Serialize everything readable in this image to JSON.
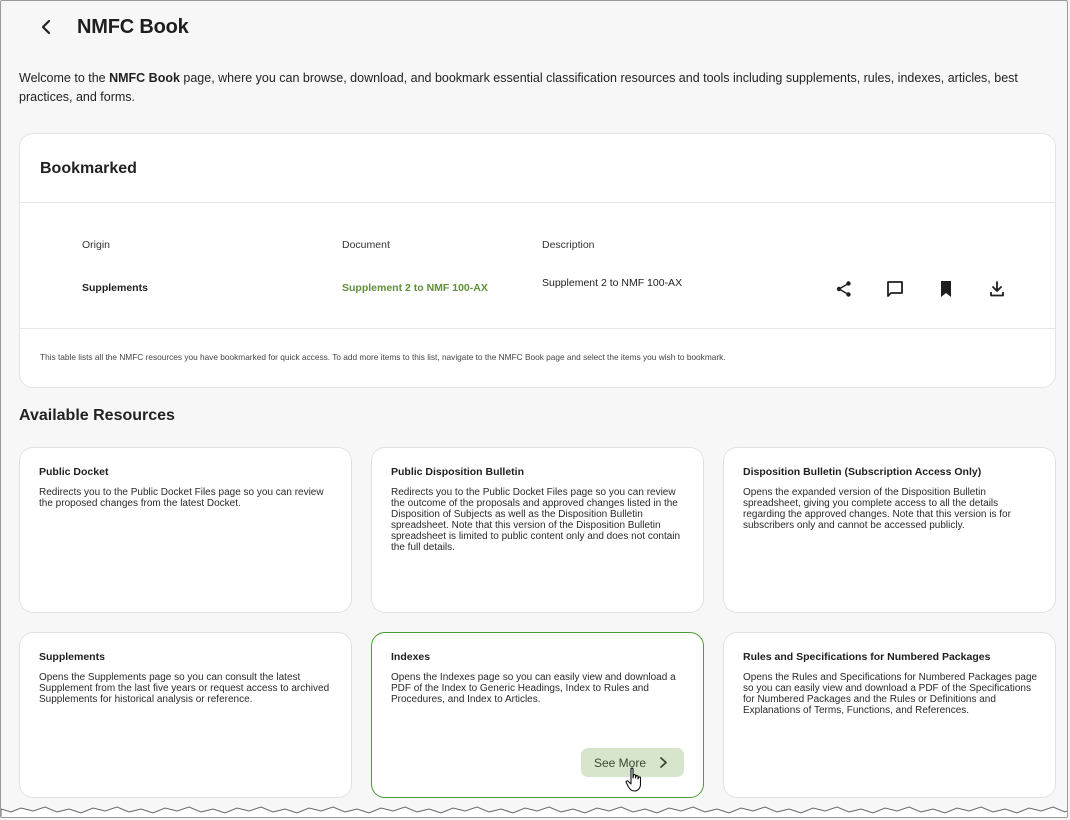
{
  "header": {
    "title": "NMFC Book"
  },
  "intro": {
    "prefix": "Welcome to the ",
    "bold": "NMFC Book",
    "suffix": " page, where you can browse, download, and bookmark essential classification resources and tools including supplements, rules, indexes, articles, best practices, and forms."
  },
  "bookmarked": {
    "title": "Bookmarked",
    "columns": {
      "origin": "Origin",
      "document": "Document",
      "description": "Description"
    },
    "row": {
      "origin": "Supplements",
      "document": "Supplement 2 to NMF 100-AX",
      "description": "Supplement 2 to NMF 100-AX"
    },
    "footer": "This table lists all the NMFC resources you have bookmarked for quick access. To add more items to this list, navigate to the NMFC Book page and select the items you wish to bookmark."
  },
  "resources": {
    "title": "Available Resources",
    "cards": [
      {
        "title": "Public Docket",
        "description": "Redirects you to the Public Docket Files page so you can review the proposed changes from the latest Docket."
      },
      {
        "title": "Public Disposition Bulletin",
        "description": "Redirects you to the Public Docket Files page so you can review the outcome of the proposals and approved changes listed in the Disposition of Subjects as well as the Disposition Bulletin spreadsheet. Note that this version of the Disposition Bulletin spreadsheet is limited to public content only and does not contain the full details."
      },
      {
        "title": "Disposition Bulletin (Subscription Access Only)",
        "description": "Opens the expanded version of the Disposition Bulletin spreadsheet, giving you complete access to all the details regarding the approved changes. Note that this version is for subscribers only and cannot be accessed publicly."
      },
      {
        "title": "Supplements",
        "description": "Opens the Supplements page so you can consult the latest Supplement from the last five years or request access to archived Supplements for historical analysis or reference."
      },
      {
        "title": "Indexes",
        "description": "Opens the Indexes page so you can easily view and download a PDF of the Index to Generic Headings, Index to Rules and Procedures, and Index to Articles.",
        "button": "See More"
      },
      {
        "title": "Rules and Specifications for Numbered Packages",
        "description": "Opens the Rules and Specifications for Numbered Packages page so you can easily view and download a PDF of the Specifications for Numbered Packages and the Rules or Definitions and Explanations of Terms, Functions, and References."
      }
    ]
  },
  "colors": {
    "accent": "#5f8f37",
    "active_border": "#4f9a38",
    "button_bg": "#d7e5cc"
  },
  "icons": {
    "back": "chevron-left-icon",
    "share": "share-icon",
    "comment": "comment-icon",
    "bookmark": "bookmark-icon",
    "download": "download-icon",
    "see_more_arrow": "chevron-right-icon",
    "cursor": "hand-pointer-icon"
  }
}
